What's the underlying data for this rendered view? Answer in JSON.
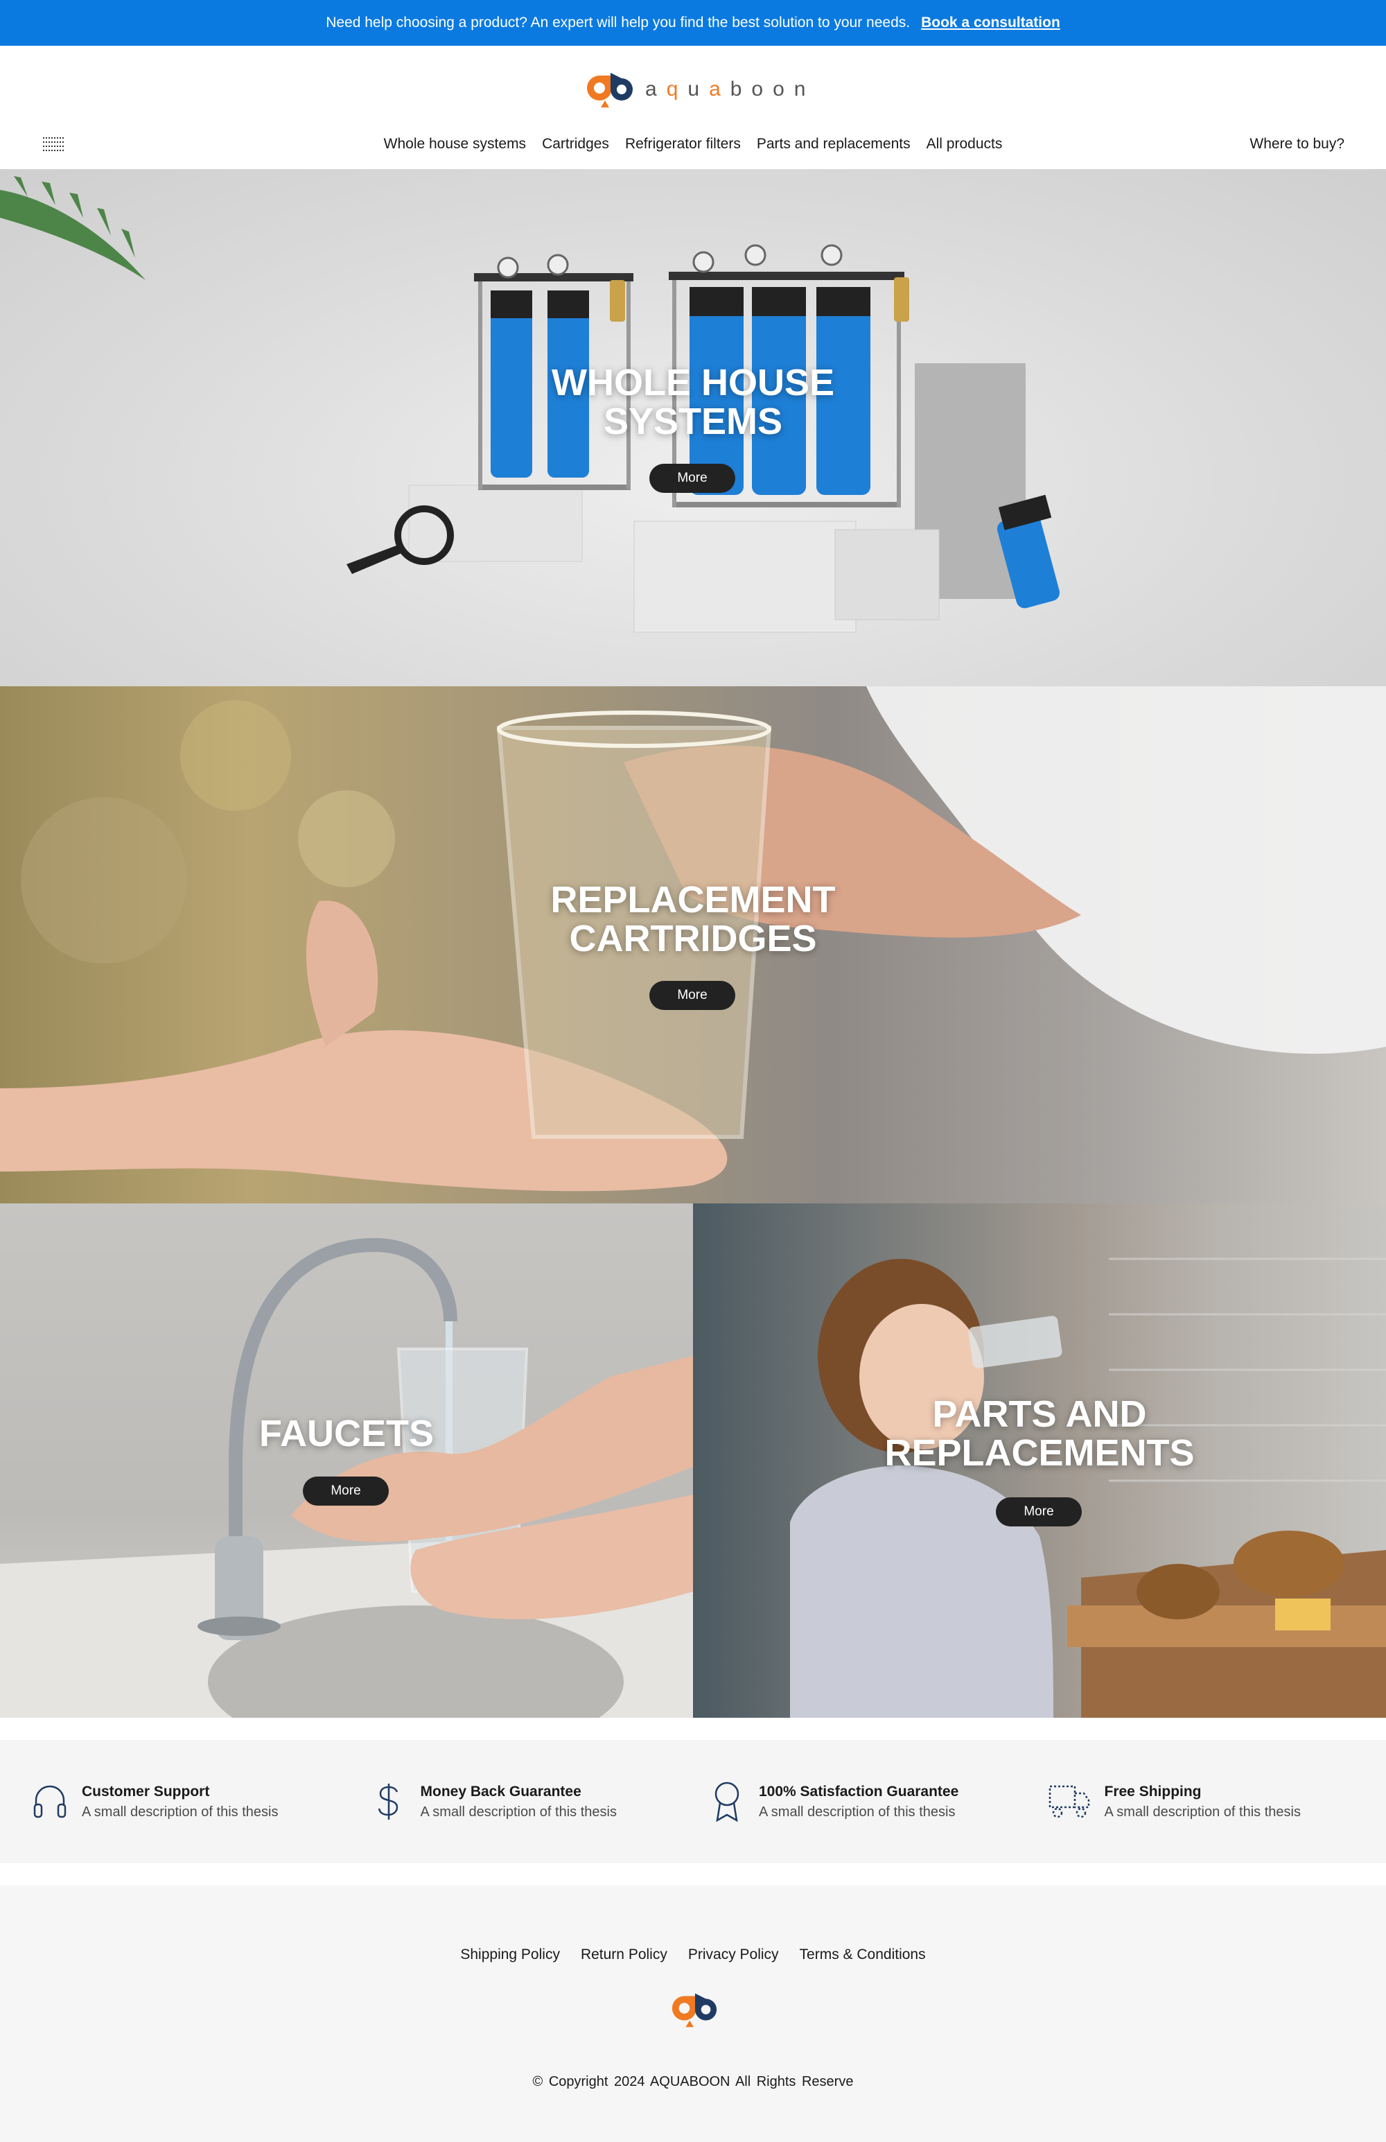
{
  "announcement": {
    "text": "Need help choosing a product? An expert will help you find the best solution to your needs.",
    "link_label": "Book a consultation"
  },
  "brand": {
    "name": "aquaboon",
    "name_upper": "AQUABOON",
    "accent": "#f07a22",
    "primary": "#0a7ae0",
    "dark": "#1f3b63"
  },
  "nav": {
    "items": [
      "Whole house systems",
      "Cartridges",
      "Refrigerator filters",
      "Parts and replacements",
      "All products"
    ],
    "where_to_buy": "Where to buy?"
  },
  "sections": [
    {
      "title_line1": "WHOLE HOUSE",
      "title_line2": "SYSTEMS",
      "button": "More"
    },
    {
      "title_line1": "REPLACEMENT",
      "title_line2": "CARTRIDGES",
      "button": "More"
    },
    {
      "title_line1": "FAUCETS",
      "title_line2": "",
      "button": "More"
    },
    {
      "title_line1": "PARTS AND",
      "title_line2": "REPLACEMENTS",
      "button": "More"
    }
  ],
  "features": [
    {
      "icon": "headphones-icon",
      "title": "Customer Support",
      "desc": "A small description of this thesis"
    },
    {
      "icon": "dollar-icon",
      "title": "Money Back Guarantee",
      "desc": "A small description of this thesis"
    },
    {
      "icon": "award-icon",
      "title": "100% Satisfaction Guarantee",
      "desc": "A small description of this thesis"
    },
    {
      "icon": "truck-icon",
      "title": "Free Shipping",
      "desc": "A small description of this thesis"
    }
  ],
  "footer": {
    "links": [
      "Shipping Policy",
      "Return Policy",
      "Privacy Policy",
      "Terms & Conditions"
    ],
    "copyright": "© Copyright 2024  AQUABOON  All Rights Reserve"
  }
}
